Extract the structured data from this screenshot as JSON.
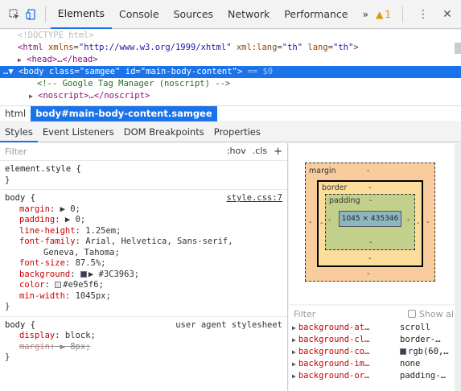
{
  "toolbar": {
    "tabs": [
      "Elements",
      "Console",
      "Sources",
      "Network",
      "Performance"
    ],
    "more": "»",
    "warning_count": "1"
  },
  "dom": {
    "doctype": "<!DOCTYPE html>",
    "html_line": {
      "tag_open": "<html",
      "attr1": "xmlns",
      "val1": "\"http://www.w3.org/1999/xhtml\"",
      "attr2": "xml:lang",
      "val2": "\"th\"",
      "attr3": "lang",
      "val3": "\"th\"",
      "close": ">"
    },
    "head_line": "<head>…</head>",
    "body_line": {
      "prefix": "…▼",
      "tag_open": "<body",
      "attr1": "class",
      "val1": "\"samgee\"",
      "attr2": "id",
      "val2": "\"main-body-content\"",
      "close": ">",
      "suffix": "== $0"
    },
    "comment_line": "<!-- Google Tag Manager (noscript) -->",
    "noscript_line": "<noscript>…</noscript>"
  },
  "breadcrumb": {
    "items": [
      "html",
      "body#main-body-content.samgee"
    ]
  },
  "subtabs": [
    "Styles",
    "Event Listeners",
    "DOM Breakpoints",
    "Properties"
  ],
  "styles": {
    "filter_placeholder": "Filter",
    "hov": ":hov",
    "cls": ".cls",
    "plus": "+",
    "element_style": {
      "selector": "element.style {",
      "close": "}"
    },
    "body_rule": {
      "selector": "body {",
      "source": "style.css:7",
      "decls": [
        {
          "name": "margin",
          "value": "▶ 0;"
        },
        {
          "name": "padding",
          "value": "▶ 0;"
        },
        {
          "name": "line-height",
          "value": "1.25em;"
        },
        {
          "name": "font-family",
          "value": "Arial, Helvetica, Sans-serif,"
        },
        {
          "name": "",
          "value": "Geneva, Tahoma;"
        },
        {
          "name": "font-size",
          "value": "87.5%;"
        },
        {
          "name": "background",
          "value": "▶ #3C3963;",
          "swatch": "#3C3963"
        },
        {
          "name": "color",
          "value": "#e9e5f6;",
          "swatch": "#e9e5f6"
        },
        {
          "name": "min-width",
          "value": "1045px;"
        }
      ],
      "close": "}"
    },
    "ua_rule": {
      "selector": "body {",
      "source": "user agent stylesheet",
      "decls": [
        {
          "name": "display",
          "value": "block;"
        },
        {
          "name": "margin",
          "value": "▶ 8px;",
          "struck": true
        }
      ],
      "close": "}"
    }
  },
  "boxmodel": {
    "margin_label": "margin",
    "border_label": "border",
    "padding_label": "padding",
    "dash": "-",
    "content": "1045 × 435346",
    "colors": {
      "margin": "#f9cc9d",
      "border": "#fddd9b",
      "padding": "#c3d08b",
      "content": "#8cb6c0"
    }
  },
  "computed": {
    "filter_placeholder": "Filter",
    "show_all": "Show all",
    "rows": [
      {
        "name": "background-at…",
        "value": "scroll"
      },
      {
        "name": "background-cl…",
        "value": "border-…"
      },
      {
        "name": "background-co…",
        "value": "rgb(60,…",
        "swatch": "#3C3963"
      },
      {
        "name": "background-im…",
        "value": "none"
      },
      {
        "name": "background-or…",
        "value": "padding-…"
      }
    ]
  },
  "colors": {
    "accent": "#1a73e8",
    "tag": "#881280",
    "attr": "#994500",
    "value": "#1a1aa6",
    "property": "#c80000"
  }
}
